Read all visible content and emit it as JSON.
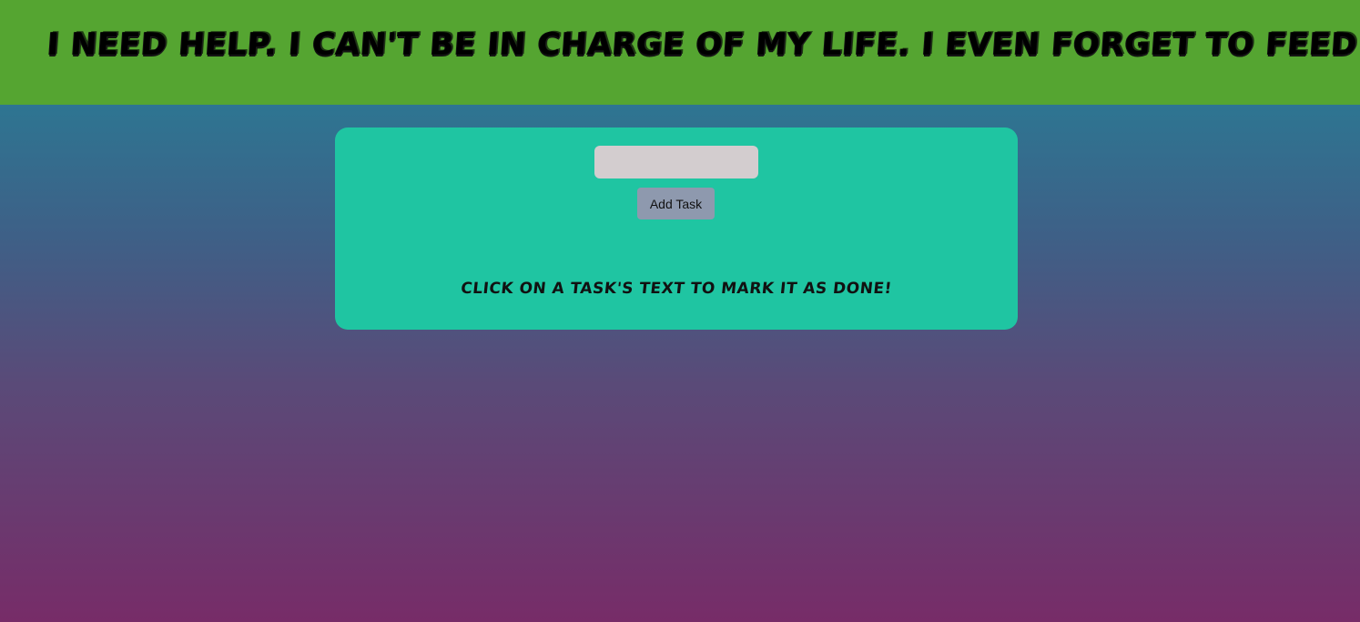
{
  "header": {
    "title": "I need help. I can't be in charge of my life. I even forget to feed myself."
  },
  "task_form": {
    "input_value": "",
    "input_placeholder": "",
    "add_button_label": "Add Task"
  },
  "hint": {
    "text": "Click on a task's text to mark it as done!"
  },
  "colors": {
    "header_bg": "#55a531",
    "panel_bg": "#1fc5a2",
    "input_bg": "#d3cdcf",
    "button_bg": "#8e99ae",
    "gradient_top": "#21869a",
    "gradient_bottom": "#772c68"
  }
}
